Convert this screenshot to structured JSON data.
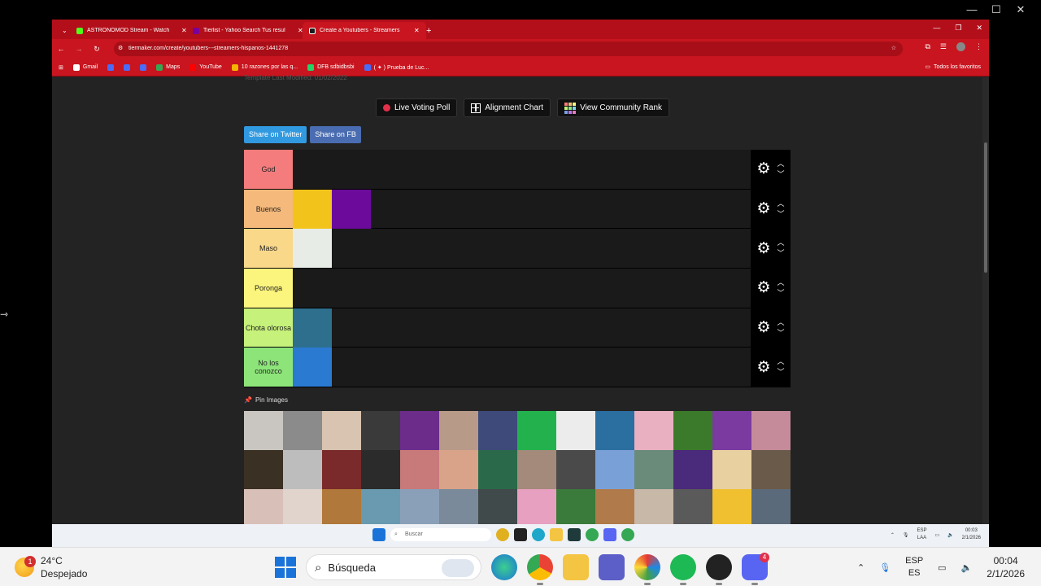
{
  "window": {
    "minimize": "—",
    "maximize": "☐",
    "close": "✕"
  },
  "browser": {
    "tabs": [
      {
        "title": "ASTRONOMOD Stream - Watch",
        "fav_color": "#53fc18",
        "close": "✕"
      },
      {
        "title": "Tierlist - Yahoo Search Tus resul",
        "fav_color": "#7b0099",
        "close": "✕"
      },
      {
        "title": "Create a Youtubers - Streamers",
        "fav_color": "#1c1c1c",
        "close": "✕"
      }
    ],
    "new_tab": "+",
    "controls": {
      "minimize": "—",
      "restore": "❐",
      "close": "✕"
    },
    "url": "tiermaker.com/create/youtubers---streamers-hispanos-1441278",
    "bookmarks": [
      {
        "label": "Gmail",
        "color": "#ffffff"
      },
      {
        "label": "",
        "color": "#4a6cf7"
      },
      {
        "label": "",
        "color": "#4a6cf7"
      },
      {
        "label": "",
        "color": "#4a6cf7"
      },
      {
        "label": "Maps",
        "color": "#34a853"
      },
      {
        "label": "YouTube",
        "color": "#ff0000"
      },
      {
        "label": "10 razones por las q...",
        "color": "#f4b400"
      },
      {
        "label": "DFB sdbidbsbi",
        "color": "#25d366"
      },
      {
        "label": "( ✦ ) Prueba de Luc...",
        "color": "#4a6cf7"
      }
    ],
    "all_bookmarks": "Todos los favoritos"
  },
  "page": {
    "template_note": "Template Last Modified: 01/02/2022",
    "buttons": {
      "live_poll": "Live Voting Poll",
      "alignment_chart": "Alignment Chart",
      "community_rank": "View Community Rank"
    },
    "share_twitter": "Share on Twitter",
    "share_fb": "Share on FB",
    "tiers": [
      {
        "label": "God",
        "color": "#f47c7c",
        "items": []
      },
      {
        "label": "Buenos",
        "color": "#f5b97b",
        "items": [
          "#f2c31a",
          "#6b0a9b"
        ]
      },
      {
        "label": "Maso",
        "color": "#f9d88a",
        "items": [
          "#e7ece6"
        ]
      },
      {
        "label": "Poronga",
        "color": "#fbf47d",
        "items": []
      },
      {
        "label": "Chota olorosa",
        "color": "#c6f17a",
        "items": [
          "#2d6f8d"
        ]
      },
      {
        "label": "No los conozco",
        "color": "#8de57a",
        "items": [
          "#2a7ad1"
        ]
      }
    ],
    "pin_label": "Pin Images",
    "pool": [
      "#c9c6c1",
      "#8b8b8b",
      "#d8c4b0",
      "#3a3a3a",
      "#6b2c8a",
      "#b89a88",
      "#3d4a7a",
      "#23b14d",
      "#ececec",
      "#2b6ea0",
      "#e8b0c0",
      "#3b7a2a",
      "#7a3aa0",
      "#c58b9a",
      "#3b3024",
      "#bdbdbd",
      "#7a2a2a",
      "#2b2b2b",
      "#c87a7a",
      "#d9a38a",
      "#2a6a4a",
      "#a38a7a",
      "#4a4a4a",
      "#7aa0d8",
      "#6a8a7a",
      "#4a2a7a",
      "#e8d0a0",
      "#6a5a4a",
      "#d8c0b8",
      "#e0d4cc",
      "#b0783a",
      "#6a9ab0",
      "#8aa0b8",
      "#7a8a9a",
      "#404a4a",
      "#e8a0c0",
      "#3a7a3a",
      "#b07a4a",
      "#c8b8a8",
      "#5a5a5a",
      "#f0c030",
      "#5a6a7a"
    ]
  },
  "inner_taskbar": {
    "search": "Buscar",
    "lang_top": "ESP",
    "lang_bottom": "LAA",
    "time": "00:03",
    "date": "2/1/2026"
  },
  "taskbar": {
    "weather_badge": "1",
    "temperature": "24°C",
    "condition": "Despejado",
    "search": "Búsqueda",
    "discord_badge": "4",
    "lang_top": "ESP",
    "lang_bottom": "ES",
    "time": "00:04",
    "date": "2/1/2026"
  }
}
